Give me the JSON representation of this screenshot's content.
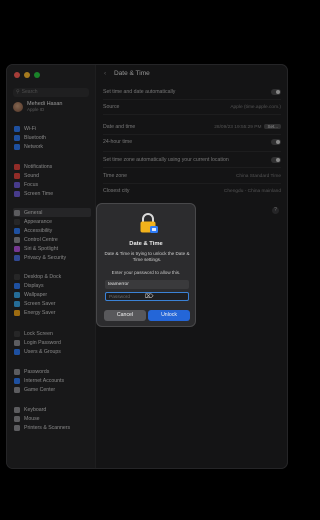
{
  "window": {
    "title": "Date & Time"
  },
  "sidebar": {
    "search_placeholder": "Search",
    "user": {
      "name": "Mehedi Hasan",
      "subtitle": "Apple ID"
    },
    "items": [
      {
        "label": "Wi-Fi",
        "color": "#2f7cf6"
      },
      {
        "label": "Bluetooth",
        "color": "#2f7cf6"
      },
      {
        "label": "Network",
        "color": "#2f7cf6"
      },
      {
        "label": "Notifications",
        "color": "#e0443e"
      },
      {
        "label": "Sound",
        "color": "#e0443e"
      },
      {
        "label": "Focus",
        "color": "#6e5bd6"
      },
      {
        "label": "Screen Time",
        "color": "#6e5bd6"
      },
      {
        "label": "General",
        "color": "#8e8e93"
      },
      {
        "label": "Appearance",
        "color": "#3b3b3d"
      },
      {
        "label": "Accessibility",
        "color": "#2f7cf6"
      },
      {
        "label": "Control Centre",
        "color": "#8e8e93"
      },
      {
        "label": "Siri & Spotlight",
        "color": "#b556e0"
      },
      {
        "label": "Privacy & Security",
        "color": "#4b6fe0"
      },
      {
        "label": "Desktop & Dock",
        "color": "#3b3b3d"
      },
      {
        "label": "Displays",
        "color": "#2f7cf6"
      },
      {
        "label": "Wallpaper",
        "color": "#39a6e8"
      },
      {
        "label": "Screen Saver",
        "color": "#39a6e8"
      },
      {
        "label": "Energy Saver",
        "color": "#f2a51a"
      },
      {
        "label": "Lock Screen",
        "color": "#3b3b3d"
      },
      {
        "label": "Login Password",
        "color": "#8e8e93"
      },
      {
        "label": "Users & Groups",
        "color": "#2f7cf6"
      },
      {
        "label": "Passwords",
        "color": "#8e8e93"
      },
      {
        "label": "Internet Accounts",
        "color": "#2f7cf6"
      },
      {
        "label": "Game Center",
        "color": "#8e8e93"
      },
      {
        "label": "Keyboard",
        "color": "#8e8e93"
      },
      {
        "label": "Mouse",
        "color": "#8e8e93"
      },
      {
        "label": "Printers & Scanners",
        "color": "#8e8e93"
      }
    ]
  },
  "settings": {
    "auto_label": "Set time and date automatically",
    "source_label": "Source",
    "source_value": "Apple (time.apple.com.)",
    "date_time_label": "Date and time",
    "date_time_value": "28/09/23 19:55:29 PM",
    "set_button": "Set...",
    "hour24_label": "24-hour time",
    "timezone_auto_label": "Set time zone automatically using your current location",
    "timezone_label": "Time zone",
    "timezone_value": "China Standard Time",
    "city_label": "Closest city",
    "city_value": "Chengdu - China mainland",
    "help": "?"
  },
  "dialog": {
    "title": "Date & Time",
    "message": "Date & Time is trying to unlock the Date & Time settings.",
    "prompt": "Enter your password to allow this.",
    "username_value": "teamerror",
    "password_placeholder": "Password",
    "cancel_label": "Cancel",
    "unlock_label": "Unlock"
  }
}
